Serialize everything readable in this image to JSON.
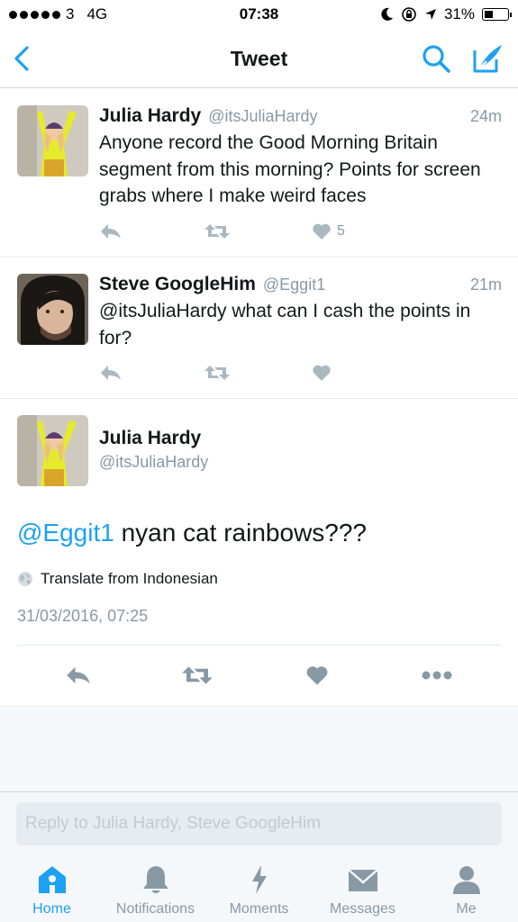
{
  "status_bar": {
    "carrier": "3",
    "network": "4G",
    "time": "07:38",
    "battery": "31%",
    "battery_level": 0.31
  },
  "nav": {
    "title": "Tweet",
    "back_icon": "chevron-left-icon",
    "search_icon": "search-icon",
    "compose_icon": "compose-icon"
  },
  "colors": {
    "accent": "#1da1f2",
    "muted": "#8899a6",
    "text": "#14171a"
  },
  "tweets": [
    {
      "name": "Julia Hardy",
      "handle": "@itsJuliaHardy",
      "time": "24m",
      "text": "Anyone record the Good Morning Britain segment from this morning? Points for screen grabs where I make weird faces",
      "likes": "5"
    },
    {
      "name": "Steve GoogleHim",
      "handle": "@Eggit1",
      "time": "21m",
      "text": "@itsJuliaHardy what can I cash the points in for?",
      "likes": ""
    }
  ],
  "focused_tweet": {
    "name": "Julia Hardy",
    "handle": "@itsJuliaHardy",
    "mention": "@Eggit1",
    "text": " nyan cat rainbows???",
    "translate": "Translate from Indonesian",
    "timestamp": "31/03/2016, 07:25"
  },
  "reply": {
    "placeholder": "Reply to Julia Hardy, Steve GoogleHim"
  },
  "tabs": [
    {
      "label": "Home",
      "icon": "home-icon",
      "active": true
    },
    {
      "label": "Notifications",
      "icon": "bell-icon",
      "active": false
    },
    {
      "label": "Moments",
      "icon": "lightning-icon",
      "active": false
    },
    {
      "label": "Messages",
      "icon": "envelope-icon",
      "active": false
    },
    {
      "label": "Me",
      "icon": "person-icon",
      "active": false
    }
  ]
}
